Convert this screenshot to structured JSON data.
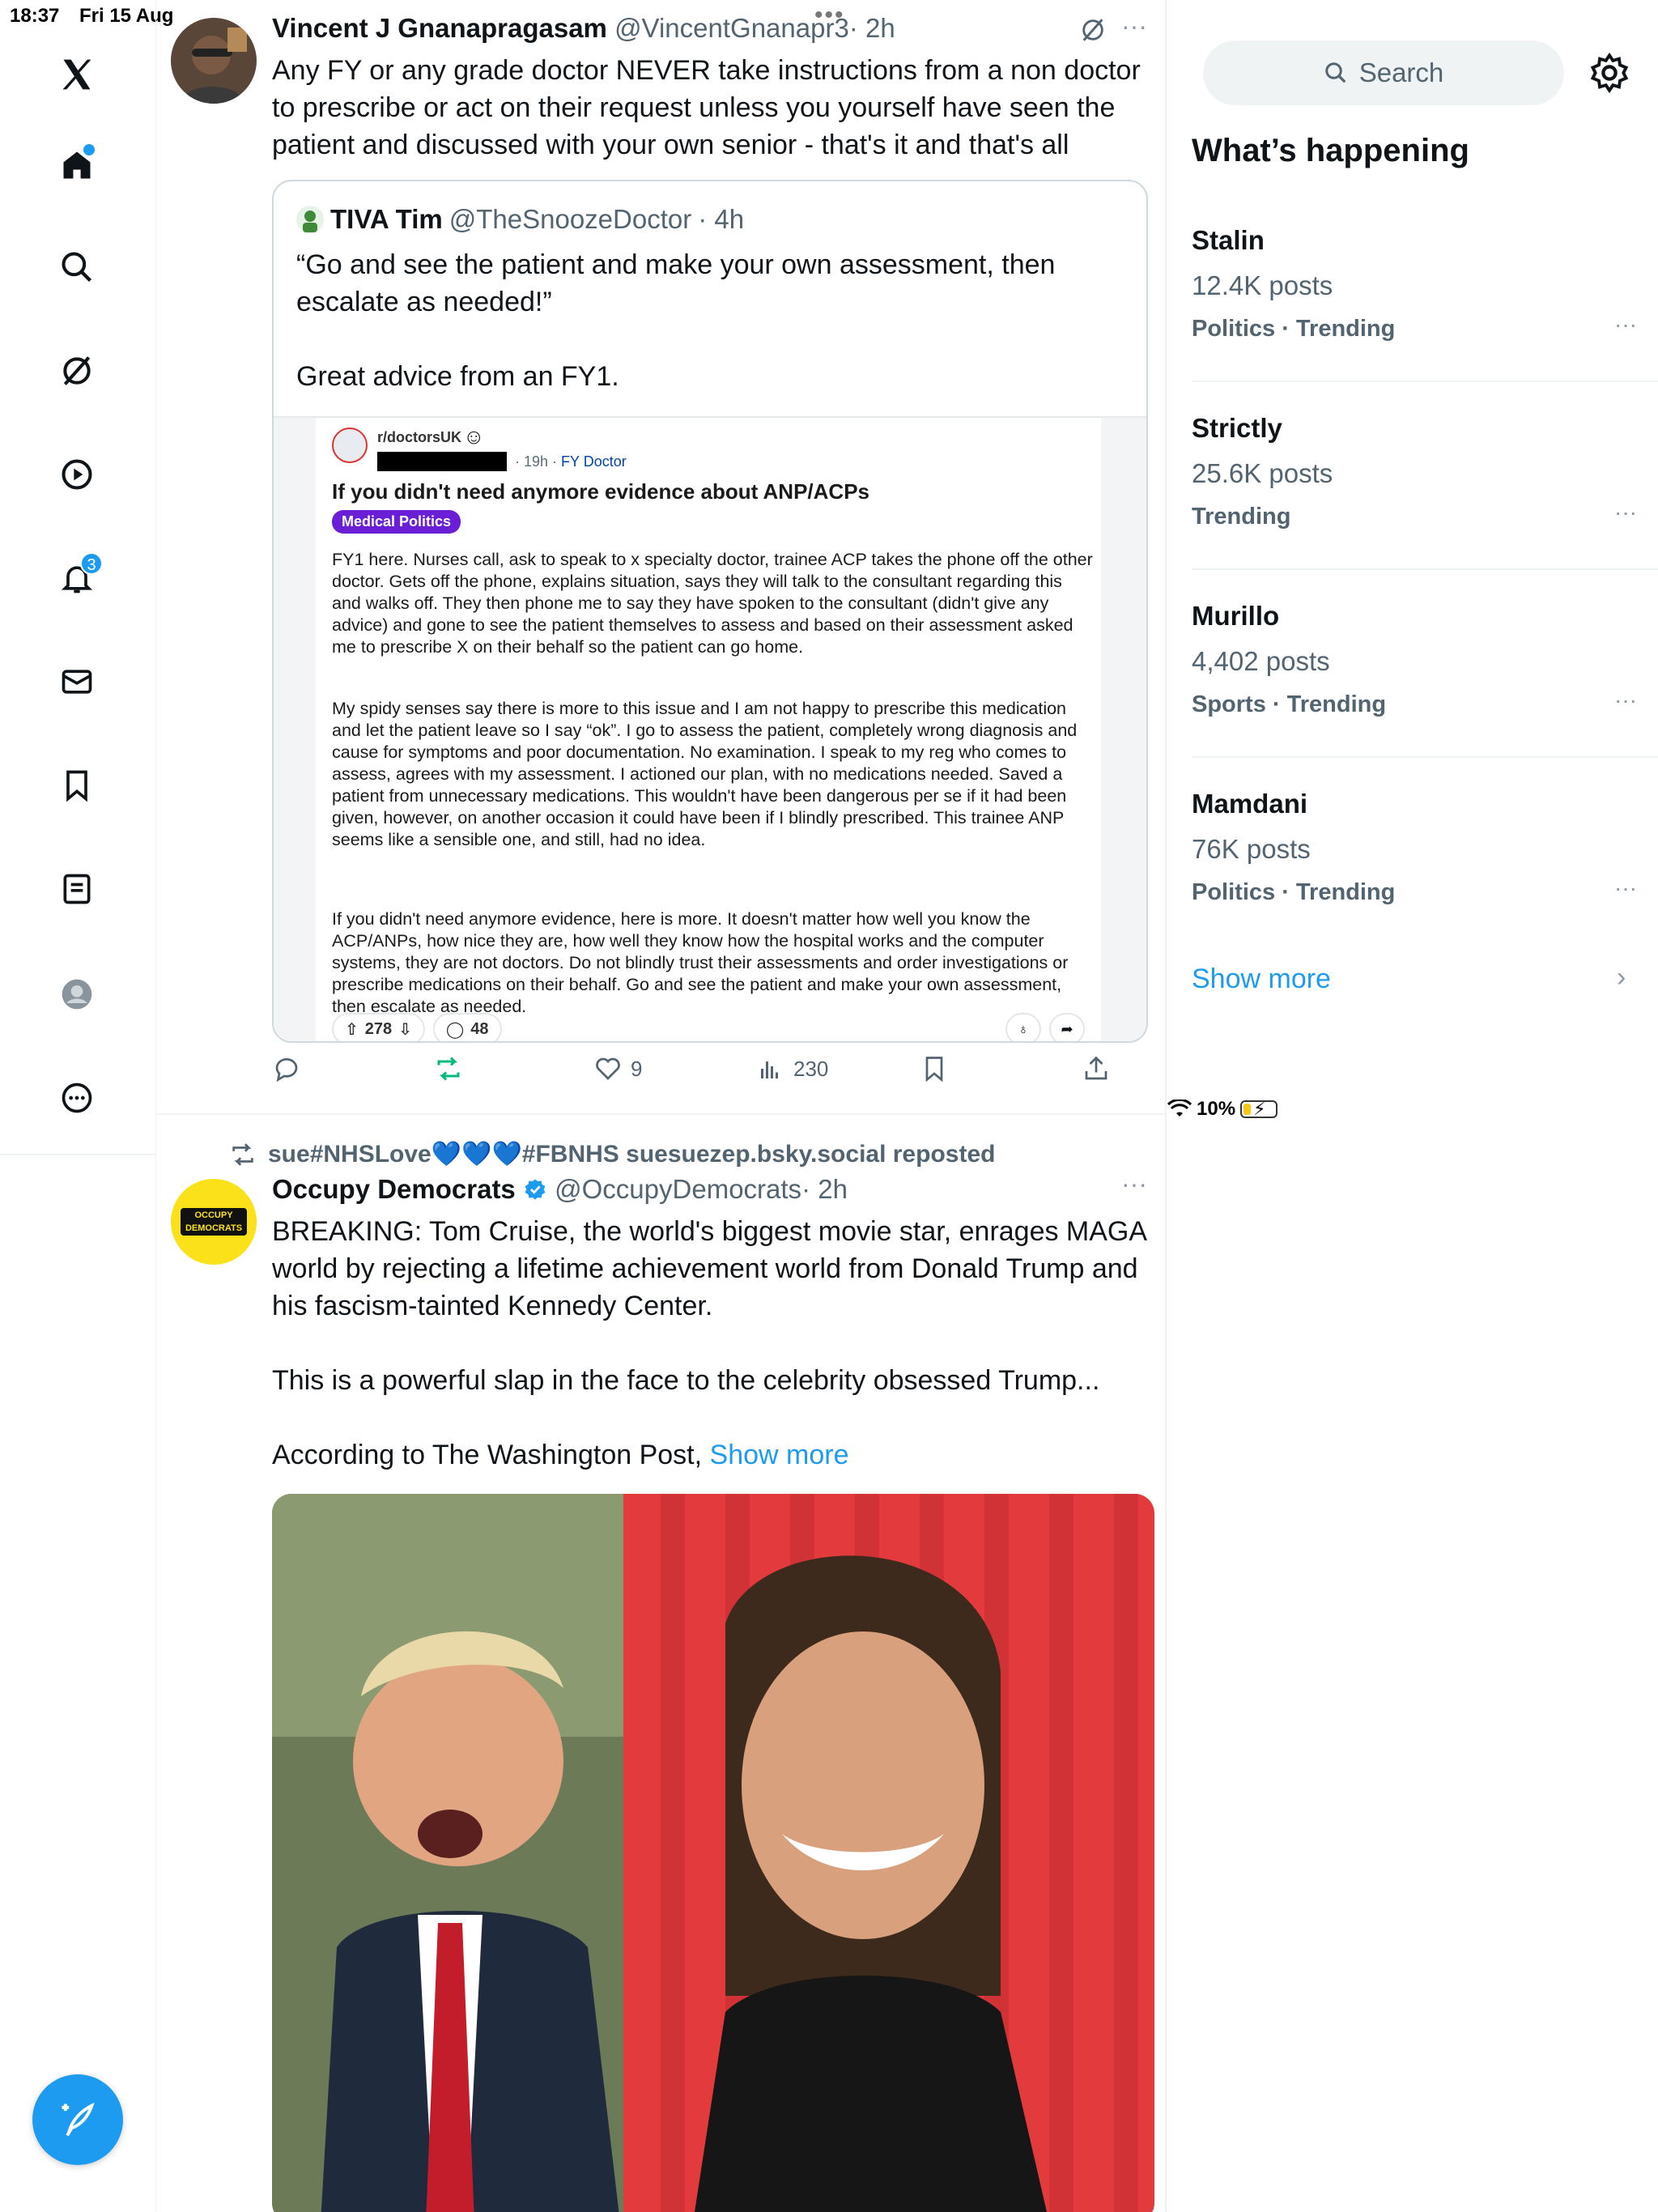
{
  "status_bar": {
    "time": "18:37",
    "date": "Fri 15 Aug",
    "battery": "10%"
  },
  "nav": {
    "notification_badge": "3"
  },
  "post1": {
    "name": "Vincent J Gnanapragasam",
    "handle": "@VincentGnanapr3",
    "time": "· 2h",
    "text": "Any FY or any grade doctor NEVER take instructions from a non doctor to prescribe or act on their request unless you yourself have seen the patient and discussed with your own senior - that's it and that's all",
    "quote": {
      "name": "TIVA Tim",
      "handle": "@TheSnoozeDoctor",
      "time": "· 4h",
      "text_line1": "“Go and see the patient and make your own assessment, then escalate as needed!”",
      "text_line2": "Great advice from an FY1.",
      "reddit": {
        "subreddit": "r/doctorsUK",
        "time": "· 19h ·",
        "flair": "FY Doctor",
        "title": "If you didn't need anymore evidence about ANP/ACPs",
        "tag": "Medical Politics",
        "para1": "FY1 here. Nurses call, ask to speak to x specialty doctor, trainee ACP takes the phone off the other doctor. Gets off the phone, explains situation, says they will talk to the consultant regarding this and walks off. They then phone me to say they have spoken to the consultant (didn't give any advice) and gone to see the patient themselves to assess and based on their assessment asked me to prescribe X on their behalf so the patient can go home.",
        "para2": "My spidy senses say there is more to this issue and I am not happy to prescribe this medication and let the patient leave so I say “ok”. I go to assess the patient, completely wrong diagnosis and cause for symptoms and poor documentation. No examination. I speak to my reg who comes to assess, agrees with my assessment. I actioned our plan, with no medications needed. Saved a patient from unnecessary medications. This wouldn't have been dangerous per se if it had been given, however, on another occasion it could have been if I blindly prescribed. This trainee ANP seems like a sensible one, and still, had no idea.",
        "para3": "If you didn't need anymore evidence, here is more. It doesn't matter how well you know the ACP/ANPs, how nice they are, how well they know how the hospital works and the computer systems, they are not doctors. Do not blindly trust their assessments and order investigations or prescribe medications on their behalf. Go and see the patient and make your own assessment, then escalate as needed.",
        "upvotes": "278",
        "comments": "48"
      }
    },
    "likes": "9",
    "views": "230"
  },
  "post2": {
    "reposted_by": "sue#NHSLove💙💙💙#FBNHS suesuezep.bsky.social reposted",
    "name": "Occupy Democrats",
    "handle": "@OccupyDemocrats",
    "time": "· 2h",
    "avatar_text": "OCCUPY DEMOCRATS",
    "para1": "BREAKING: Tom Cruise, the world's biggest movie star, enrages MAGA world by rejecting a lifetime achievement world from Donald Trump and his fascism-tainted Kennedy Center.",
    "para2": "This is a powerful slap in the face to the celebrity obsessed Trump...",
    "para3": "According to The Washington Post,",
    "show_more": "Show more"
  },
  "sidebar": {
    "search_placeholder": "Search",
    "heading": "What’s happening",
    "trends": [
      {
        "name": "Stalin",
        "count": "12.4K posts",
        "category": "Politics · Trending"
      },
      {
        "name": "Strictly",
        "count": "25.6K posts",
        "category": "Trending"
      },
      {
        "name": "Murillo",
        "count": "4,402 posts",
        "category": "Sports · Trending"
      },
      {
        "name": "Mamdani",
        "count": "76K posts",
        "category": "Politics · Trending"
      }
    ],
    "show_more": "Show more"
  },
  "colors": {
    "accent": "#1d9bf0",
    "repost_green": "#00ba7c",
    "reddit_tag": "#6a1fd6"
  },
  "icons": [
    "x-logo-icon",
    "home-icon",
    "search-icon",
    "grok-icon",
    "video-icon",
    "bell-icon",
    "mail-icon",
    "bookmark-icon",
    "lists-icon",
    "profile-icon",
    "more-icon",
    "compose-icon",
    "reply-icon",
    "repost-icon",
    "like-icon",
    "views-icon",
    "share-icon",
    "gear-icon",
    "chevron-right-icon",
    "verified-icon"
  ]
}
